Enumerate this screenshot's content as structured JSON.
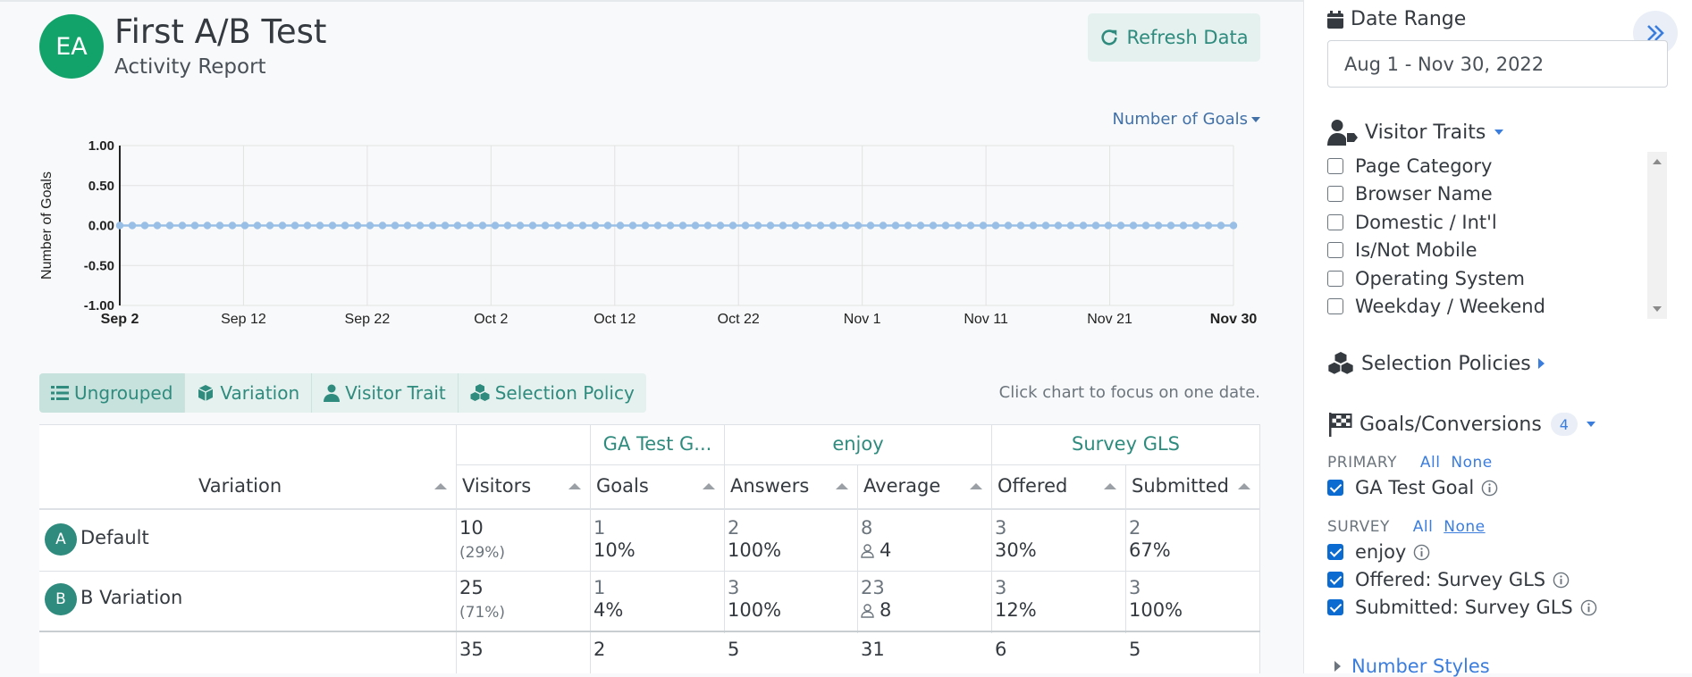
{
  "header": {
    "avatar_initials": "EA",
    "title": "First A/B Test",
    "subtitle": "Activity Report",
    "refresh_label": "Refresh Data",
    "metric_select": "Number of Goals"
  },
  "chart_data": {
    "type": "line",
    "ylabel": "Number of Goals",
    "ylim": [
      -1.0,
      1.0
    ],
    "yticks": [
      "1.00",
      "0.50",
      "0.00",
      "-0.50",
      "-1.00"
    ],
    "xticks": [
      "Sep 2",
      "Sep 12",
      "Sep 22",
      "Oct 2",
      "Oct 12",
      "Oct 22",
      "Nov 1",
      "Nov 11",
      "Nov 21",
      "Nov 30"
    ],
    "x_start": "Sep 2",
    "x_end": "Nov 30",
    "series": [
      {
        "color": "#99bfe6",
        "constant_value": 0.0,
        "num_points": 90
      }
    ],
    "grid": true
  },
  "group_tabs": [
    {
      "label": "Ungrouped",
      "icon": "list-icon",
      "active": true
    },
    {
      "label": "Variation",
      "icon": "cube-icon",
      "active": false
    },
    {
      "label": "Visitor Trait",
      "icon": "user-icon",
      "active": false
    },
    {
      "label": "Selection Policy",
      "icon": "cubes-icon",
      "active": false
    }
  ],
  "chart_hint": "Click chart to focus on one date.",
  "table": {
    "group_headers": [
      "GA Test G...",
      "enjoy",
      "Survey GLS"
    ],
    "columns": [
      "Variation",
      "Visitors",
      "Goals",
      "Answers",
      "Average",
      "Offered",
      "Submitted"
    ],
    "rows": [
      {
        "badge": "A",
        "name": "Default",
        "visitors": "10",
        "visitors_pct": "(29%)",
        "goals_count": "1",
        "goals_pct": "10%",
        "answers_count": "2",
        "answers_pct": "100%",
        "average_total": "8",
        "average_people": "4",
        "offered_count": "3",
        "offered_pct": "30%",
        "submitted_count": "2",
        "submitted_pct": "67%"
      },
      {
        "badge": "B",
        "name": "B Variation",
        "visitors": "25",
        "visitors_pct": "(71%)",
        "goals_count": "1",
        "goals_pct": "4%",
        "answers_count": "3",
        "answers_pct": "100%",
        "average_total": "23",
        "average_people": "8",
        "offered_count": "3",
        "offered_pct": "12%",
        "submitted_count": "3",
        "submitted_pct": "100%"
      }
    ],
    "totals": {
      "visitors": "35",
      "goals": "2",
      "answers": "5",
      "average": "31",
      "offered": "6",
      "submitted": "5"
    }
  },
  "sidebar": {
    "date_range_label": "Date Range",
    "date_range_value": "Aug 1 - Nov 30, 2022",
    "visitor_traits_label": "Visitor Traits",
    "traits": [
      "Page Category",
      "Browser Name",
      "Domestic / Int'l",
      "Is/Not Mobile",
      "Operating System",
      "Weekday / Weekend"
    ],
    "selection_policies_label": "Selection Policies",
    "goals_label": "Goals/Conversions",
    "goals_count": "4",
    "primary_label": "PRIMARY",
    "survey_label": "SURVEY",
    "all_label": "All",
    "none_label": "None",
    "primary_goals": [
      "GA Test Goal"
    ],
    "survey_goals": [
      "enjoy",
      "Offered: Survey GLS",
      "Submitted: Survey GLS"
    ],
    "number_styles_label": "Number Styles"
  },
  "colors": {
    "accent": "#2e8b7e",
    "avatar": "#12a36b",
    "link": "#3b7ddd",
    "series": "#99bfe6"
  }
}
